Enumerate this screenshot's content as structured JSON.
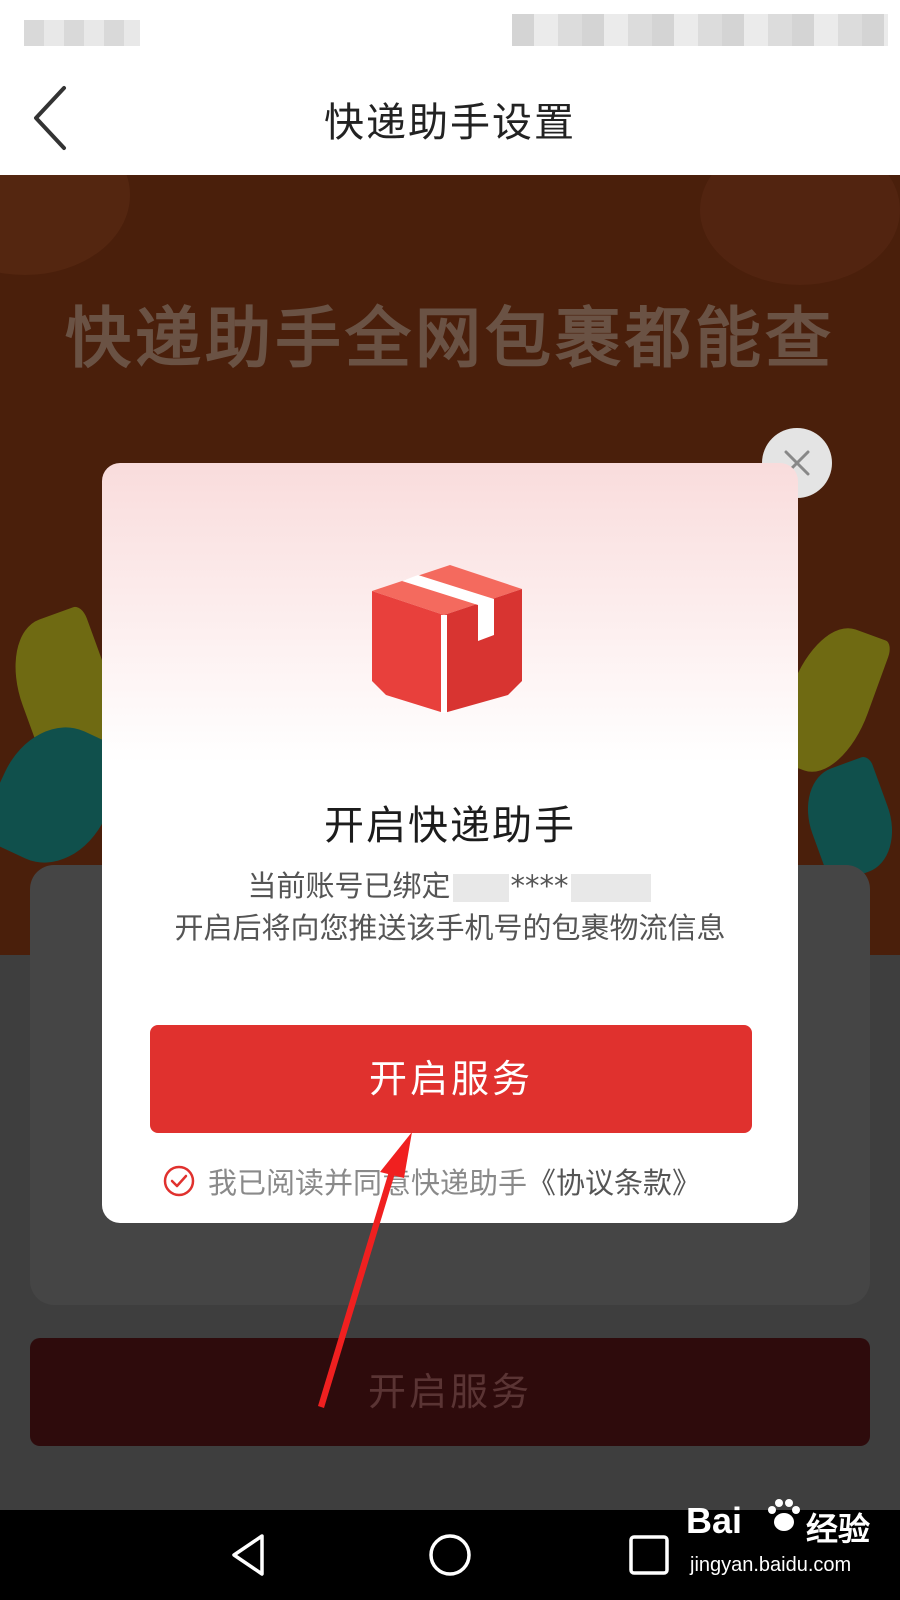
{
  "nav": {
    "title": "快递助手设置",
    "back_icon": "chevron-left-icon"
  },
  "background_page": {
    "banner_title": "快递助手全网包裹都能查",
    "button_label": "开启服务"
  },
  "modal": {
    "icon": "package-box-icon",
    "title": "开启快递助手",
    "bound_prefix": "当前账号已绑定",
    "bound_masked": "****",
    "description": "开启后将向您推送该手机号的包裹物流信息",
    "primary_button": "开启服务",
    "agreement_text": "我已阅读并同意快递助手",
    "agreement_link": "《协议条款》",
    "agreement_checked": true,
    "close_icon": "close-icon"
  },
  "system_nav": {
    "back_icon": "triangle-back-icon",
    "home_icon": "circle-home-icon",
    "recent_icon": "square-recents-icon"
  },
  "watermark": {
    "brand": "Bai",
    "brand_cn": "经验",
    "url": "jingyan.baidu.com"
  },
  "colors": {
    "accent": "#e0312e",
    "annotation_arrow": "#f02020"
  }
}
